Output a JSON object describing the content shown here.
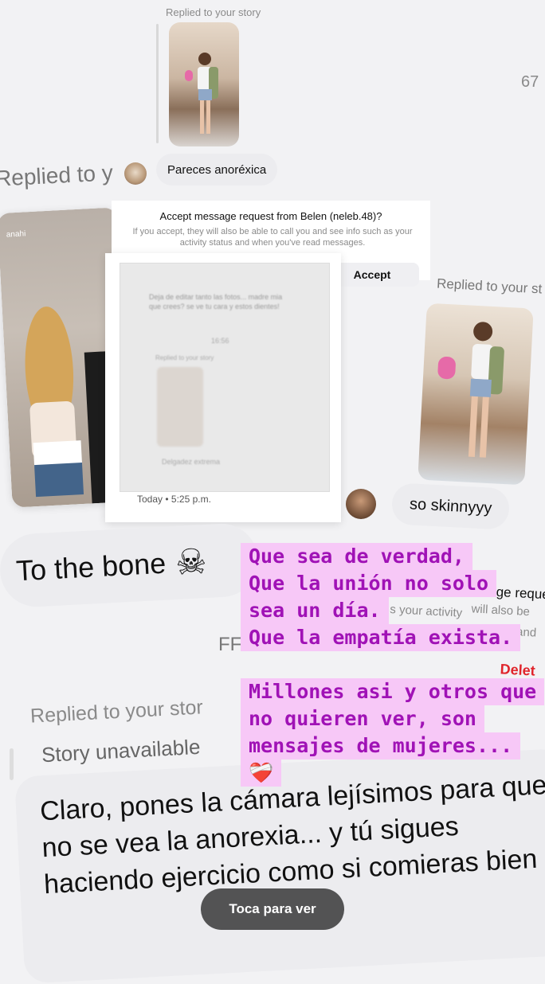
{
  "top_reply": {
    "label": "Replied to your story",
    "counter": "67"
  },
  "left_replied": {
    "label": "Replied to y"
  },
  "message1": {
    "text": "Pareces anoréxica"
  },
  "request": {
    "title": "Accept message request from Belen (neleb.48)?",
    "body": "If you accept, they will also be able to call you and see info such as your activity status and when you've read messages.",
    "accept_label": "Accept"
  },
  "story_card": {
    "username": "anahi"
  },
  "blurred_card": {
    "msg1": "Deja de editar tanto las fotos... madre mia que crees? se ve tu cara y estos dientes!",
    "time1": "16:56",
    "reply_label": "Replied to your story",
    "msg2": "Delgadez extrema",
    "timestamp": "Today • 5:25 p.m."
  },
  "right_reply": {
    "label": "Replied to your st",
    "message": "so skinnyyy"
  },
  "bone": {
    "text": "To the bone",
    "emoji": "☠"
  },
  "highlight1": {
    "lines": [
      "Que sea de verdad,",
      "Que la unión no solo",
      "sea un día.",
      "Que la empatía exista."
    ]
  },
  "highlight2": {
    "lines": [
      "Millones asi y otros que",
      "no quieren ver, son",
      "mensajes de mujeres..."
    ],
    "emoji": "❤️‍🩹"
  },
  "request2": {
    "line1": "ge reque",
    "line2": "will also be",
    "line3": "s your activity",
    "line4": "and",
    "delete_label": "Delet"
  },
  "ff_fragment": "FF",
  "lower_reply": {
    "label": "Replied to your stor",
    "unavailable": "Story unavailable"
  },
  "big_message": {
    "text": "Claro, pones la cámara lejísimos para que no se vea la anorexia... y tú sigues haciendo ejercicio como si comieras bien"
  },
  "overlay": {
    "label": "Toca para ver"
  },
  "colors": {
    "highlight_bg": "#f7c8f7",
    "highlight_text": "#a012b6",
    "delete_red": "#e0242b"
  }
}
